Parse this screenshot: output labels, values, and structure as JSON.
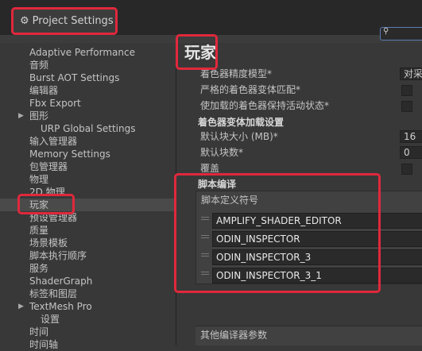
{
  "window": {
    "title": "Project Settings"
  },
  "search": {
    "placeholder": ""
  },
  "sidebar": {
    "items": [
      {
        "label": "Adaptive Performance",
        "indent": 0
      },
      {
        "label": "音频",
        "indent": 0
      },
      {
        "label": "Burst AOT Settings",
        "indent": 0
      },
      {
        "label": "编辑器",
        "indent": 0
      },
      {
        "label": "Fbx Export",
        "indent": 0
      },
      {
        "label": "图形",
        "indent": 0,
        "expandable": true
      },
      {
        "label": "URP Global Settings",
        "indent": 1
      },
      {
        "label": "输入管理器",
        "indent": 0
      },
      {
        "label": "Memory Settings",
        "indent": 0
      },
      {
        "label": "包管理器",
        "indent": 0
      },
      {
        "label": "物理",
        "indent": 0
      },
      {
        "label": "2D 物理",
        "indent": 0
      },
      {
        "label": "玩家",
        "indent": 0,
        "selected": true
      },
      {
        "label": "预设管理器",
        "indent": 0
      },
      {
        "label": "质量",
        "indent": 0
      },
      {
        "label": "场景模板",
        "indent": 0
      },
      {
        "label": "脚本执行顺序",
        "indent": 0
      },
      {
        "label": "服务",
        "indent": 0
      },
      {
        "label": "ShaderGraph",
        "indent": 0
      },
      {
        "label": "标签和图层",
        "indent": 0
      },
      {
        "label": "TextMesh Pro",
        "indent": 0,
        "expandable": true
      },
      {
        "label": "设置",
        "indent": 1
      },
      {
        "label": "时间",
        "indent": 0
      },
      {
        "label": "时间轴",
        "indent": 0
      }
    ]
  },
  "main": {
    "page_title": "玩家",
    "shader": {
      "precision_label": "着色器精度模型*",
      "precision_value": "对采",
      "strict_label": "严格的着色器变体匹配*",
      "keep_loaded_label": "使加载的着色器保持活动状态*"
    },
    "variant_loading": {
      "header": "着色器变体加载设置",
      "chunk_size_label": "默认块大小 (MB)*",
      "chunk_size_value": "16",
      "chunk_count_label": "默认块数*",
      "chunk_count_value": "0",
      "override_label": "覆盖"
    },
    "script_compilation": {
      "header": "脚本编译",
      "define_symbols_label": "脚本定义符号",
      "symbols": [
        "AMPLIFY_SHADER_EDITOR",
        "ODIN_INSPECTOR",
        "ODIN_INSPECTOR_3",
        "ODIN_INSPECTOR_3_1"
      ],
      "other_args_label": "其他编译器参数"
    }
  },
  "colors": {
    "highlight": "#e0283c",
    "background": "#383838",
    "field": "#2a2a2a",
    "selection": "#4a4a4a"
  }
}
